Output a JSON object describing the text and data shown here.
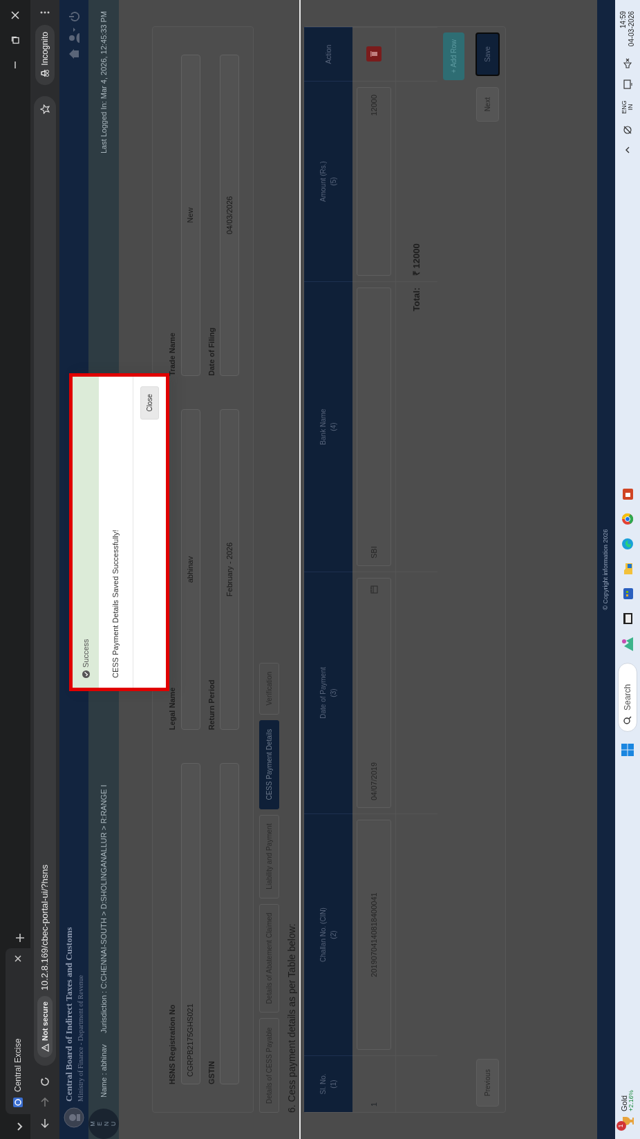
{
  "browser": {
    "tab_title": "Central Excise",
    "security_label": "Not secure",
    "url": "10.2.8.169/cbec-portal-ui/?hsns",
    "profile_label": "Incognito"
  },
  "site_header": {
    "title": "Central Board of Indirect Taxes and Customs",
    "subtitle": "Ministry of Finance - Department of Revenue"
  },
  "user_bar": {
    "menu_label": "MENU",
    "name": "Name : abhinav",
    "jurisdiction": "Jurisdiction : C:CHENNAI-SOUTH > D:SHOLINGANALLUR > R:RANGE I",
    "last_logged": "Last Logged In: Mar 4, 2026, 12:45:33 PM"
  },
  "fields": [
    {
      "label": "HSNS Registration No",
      "value": "CGRPB2175GHS021"
    },
    {
      "label": "Legal Name",
      "value": "abhinav"
    },
    {
      "label": "Trade Name",
      "value": "New"
    },
    {
      "label": "GSTIN"
    },
    {
      "label": "Return Period",
      "value": "February - 2026"
    },
    {
      "label": "Date of Filing",
      "value": "04/03/2026"
    }
  ],
  "tabs": [
    {
      "label": "Details of CESS Payable",
      "selected": false
    },
    {
      "label": "Details of Abatement Claimed",
      "selected": false
    },
    {
      "label": "Liability and Payment",
      "selected": false
    },
    {
      "label": "CESS Payment Details",
      "selected": true
    },
    {
      "label": "Verification",
      "selected": false
    }
  ],
  "section_title": "6. Cess payment details as per Table below:",
  "table": {
    "columns": [
      {
        "title": "Sl. No.",
        "number": "(1)"
      },
      {
        "title": "Challan No. (CIN)",
        "number": "(2)"
      },
      {
        "title": "Date of Payment",
        "number": "(3)"
      },
      {
        "title": "Bank Name",
        "number": "(4)"
      },
      {
        "title": "Amount (Rs.)",
        "number": "(5)"
      },
      {
        "title": "Action"
      }
    ],
    "rows": [
      {
        "sl_no": "1",
        "challan_no": "20190704140818400041",
        "date": "04/07/2019",
        "bank": "SBI",
        "amount": "12000"
      }
    ],
    "total_label": "Total:",
    "total_value": "₹ 12000"
  },
  "buttons": {
    "add_row": "+ Add Row",
    "previous": "Previous",
    "next": "Next",
    "save": "Save"
  },
  "modal": {
    "title": "Success",
    "message": "CESS Payment Details Saved Successfully!",
    "close": "Close"
  },
  "footer": {
    "copyright": "© Copyright information 2026"
  },
  "taskbar": {
    "widget_badge": "1",
    "widget_title": "Gold",
    "widget_change": "+2.16%",
    "search_placeholder": "Search",
    "language": "ENG",
    "region": "IN",
    "time": "14:59",
    "date": "04-03-2026"
  }
}
